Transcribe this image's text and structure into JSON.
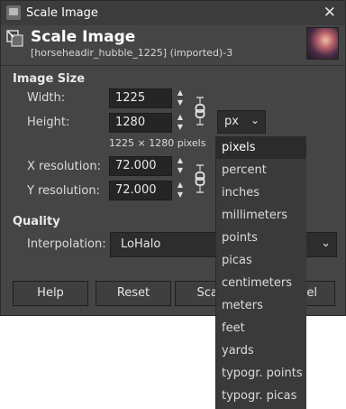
{
  "window": {
    "title": "Scale Image",
    "close_glyph": "✕"
  },
  "header": {
    "title": "Scale Image",
    "subtitle": "[horseheadir_hubble_1225] (imported)-3"
  },
  "image_size": {
    "section_label": "Image Size",
    "width_label": "Width:",
    "width_value": "1225",
    "height_label": "Height:",
    "height_value": "1280",
    "unit_value": "px",
    "pixels_info": "1225 × 1280 pixels",
    "xres_label": "X resolution:",
    "xres_value": "72.000",
    "yres_label": "Y resolution:",
    "yres_value": "72.000"
  },
  "quality": {
    "section_label": "Quality",
    "interp_label": "Interpolation:",
    "interp_value": "LoHalo"
  },
  "buttons": {
    "help": "Help",
    "reset": "Reset",
    "scale": "Scale",
    "cancel": "Cancel"
  },
  "unit_dropdown": {
    "selected": "pixels",
    "items": [
      "pixels",
      "percent",
      "inches",
      "millimeters",
      "points",
      "picas",
      "centimeters",
      "meters",
      "feet",
      "yards",
      "typogr. points",
      "typogr. picas"
    ]
  },
  "icons": {
    "spin_up": "▲",
    "spin_down": "▼",
    "chevron": "⌄"
  },
  "colors": {
    "window_bg": "#454545",
    "field_bg": "#252525",
    "accent": "#ffffff"
  }
}
